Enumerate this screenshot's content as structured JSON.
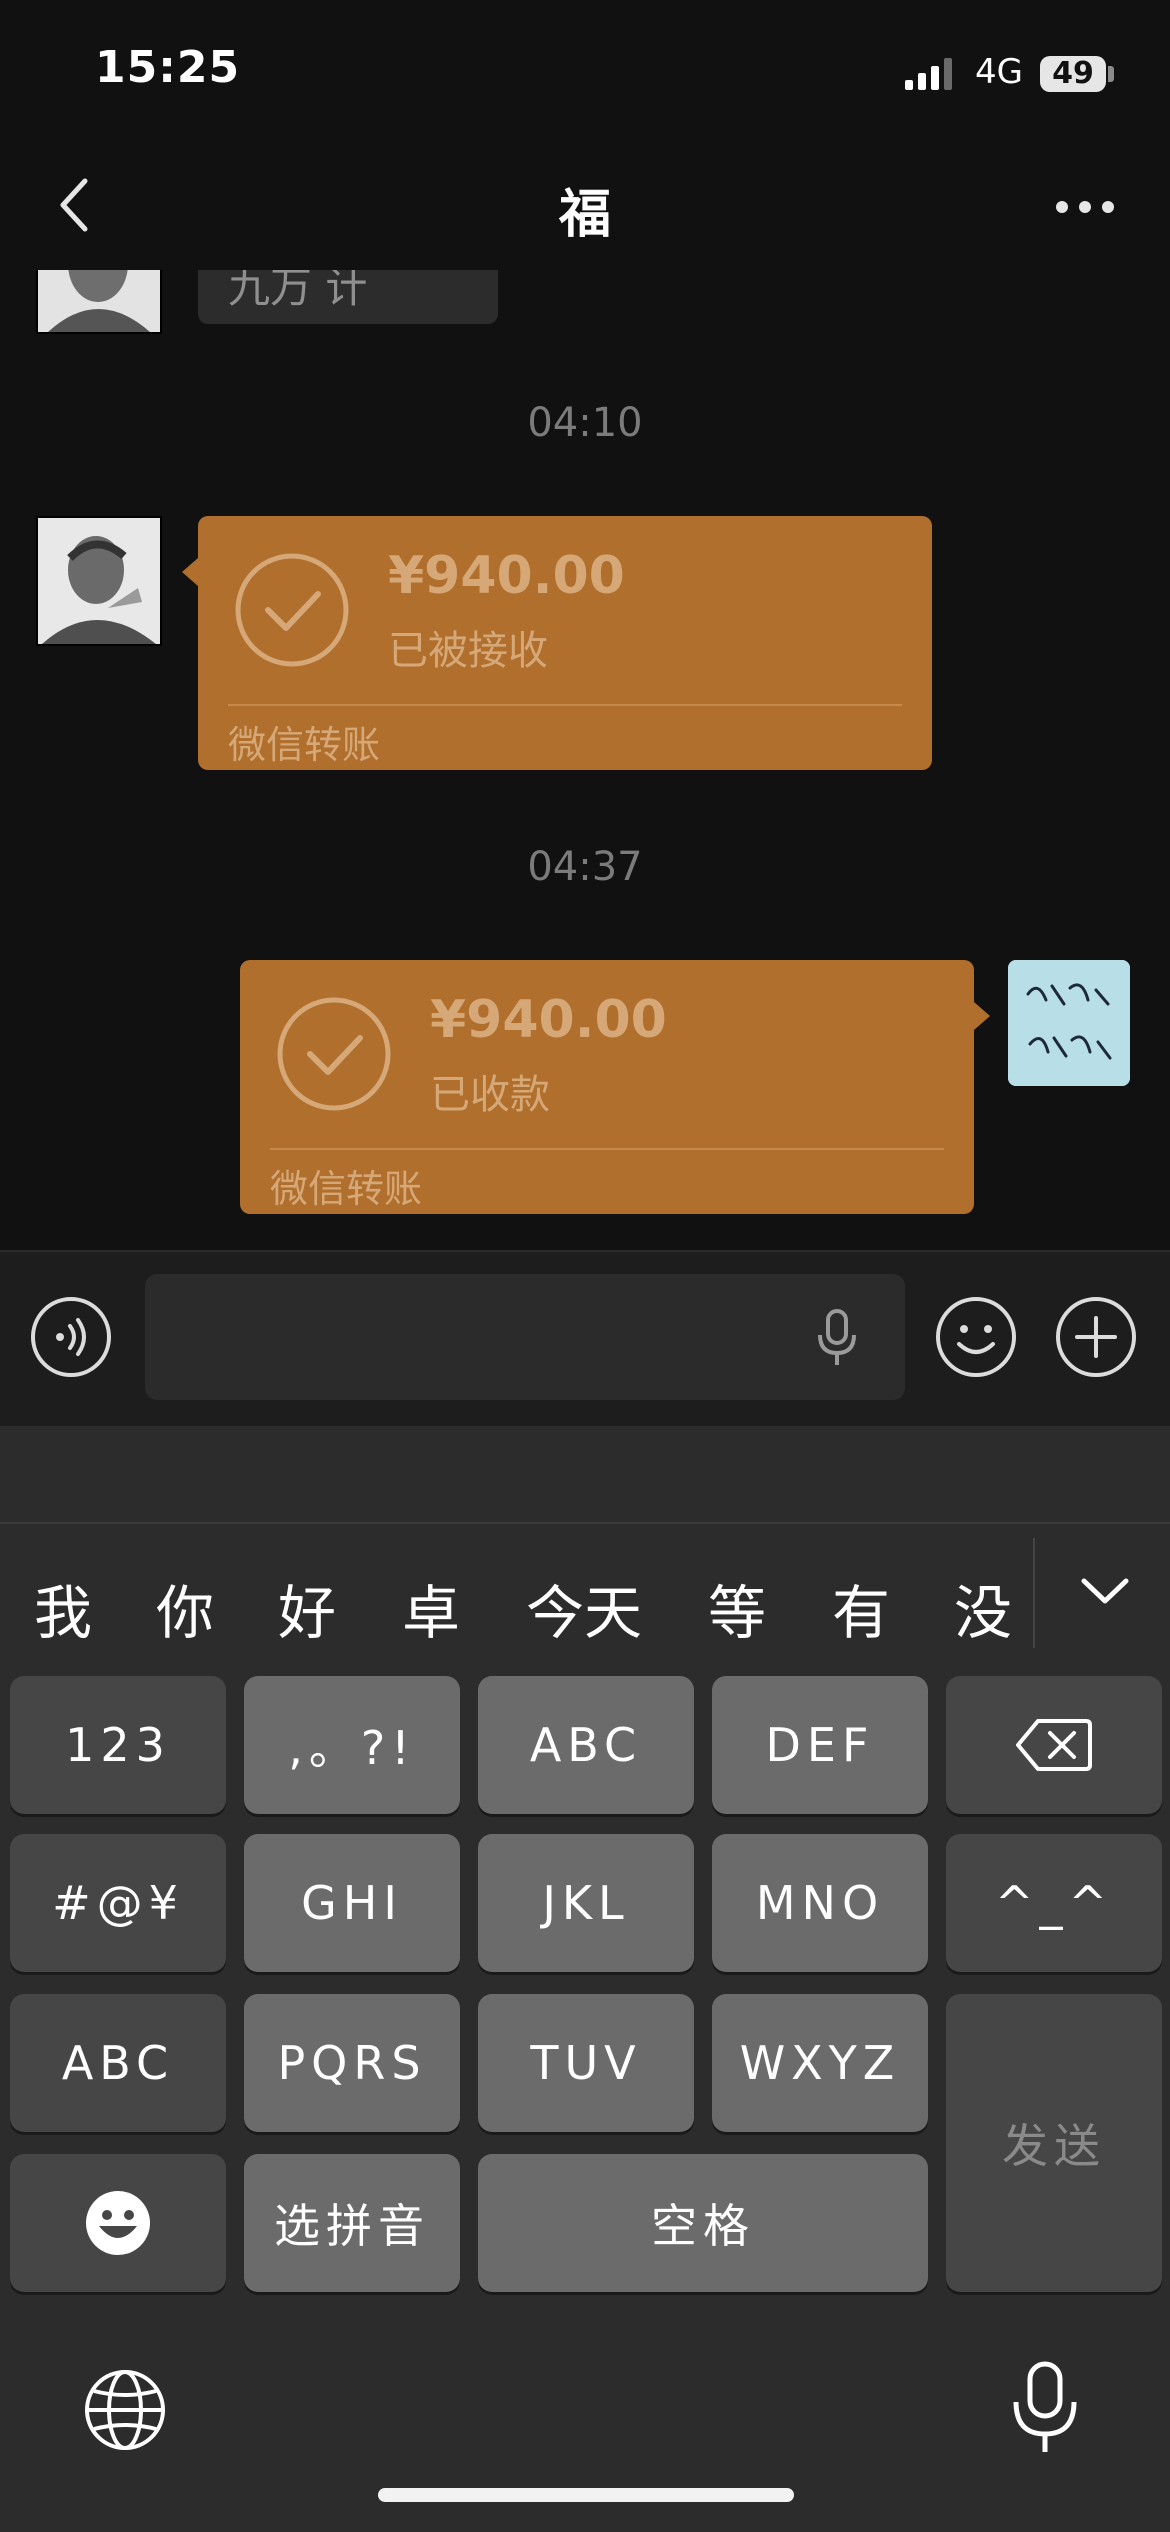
{
  "status_bar": {
    "time": "15:25",
    "network": "4G",
    "battery": "49"
  },
  "nav": {
    "title": "福"
  },
  "chat": {
    "partial_message": "九万 计",
    "messages": [
      {
        "timestamp": "04:10",
        "amount": "¥940.00",
        "status": "已被接收",
        "label": "微信转账",
        "side": "left"
      },
      {
        "timestamp": "04:37",
        "amount": "¥940.00",
        "status": "已收款",
        "label": "微信转账",
        "side": "right"
      }
    ],
    "right_avatar_text": "事不拖 话不多"
  },
  "input": {
    "value": "",
    "placeholder": ""
  },
  "keyboard": {
    "candidates": [
      "我",
      "你",
      "好",
      "卓",
      "今天",
      "等",
      "有",
      "没"
    ],
    "keys": {
      "k123": "123",
      "punct": ",。?!",
      "abc": "ABC",
      "def": "DEF",
      "symbols": "#@¥",
      "ghi": "GHI",
      "jkl": "JKL",
      "mno": "MNO",
      "face": "^_^",
      "abc_mode": "ABC",
      "pqrs": "PQRS",
      "tuv": "TUV",
      "wxyz": "WXYZ",
      "send": "发送",
      "pinyin": "选拼音",
      "space": "空格"
    }
  },
  "colors": {
    "transfer_bg": "#b06f2c",
    "background": "#111111",
    "keyboard_bg": "#2c2c2c"
  }
}
